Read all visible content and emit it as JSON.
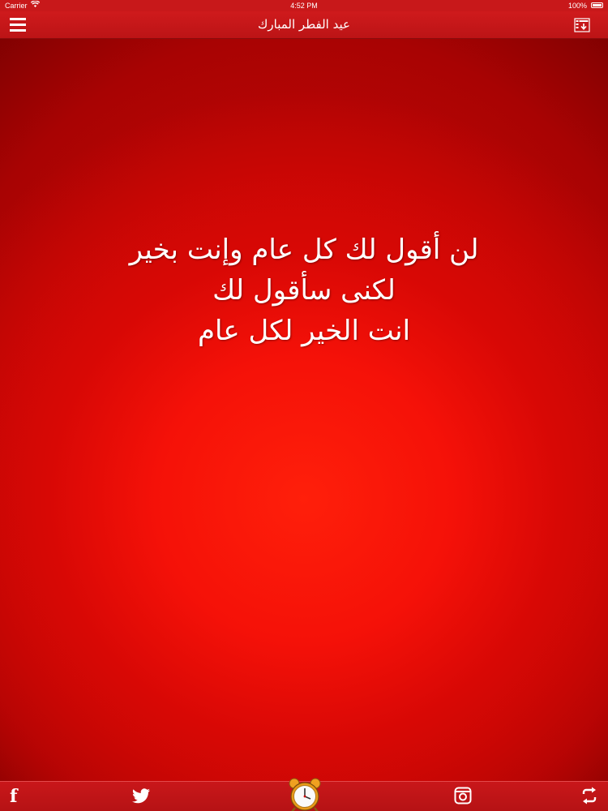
{
  "status_bar": {
    "carrier": "Carrier",
    "time": "4:52 PM",
    "battery": "100%"
  },
  "nav_bar": {
    "title": "عيد الفطر المبارك",
    "menu_icon": "hamburger-menu-icon",
    "download_icon": "list-download-icon"
  },
  "greeting": {
    "lines": [
      "لن أقول لك كل عام وإنت بخير",
      "لكنى سأقول لك",
      "انت الخير لكل عام"
    ]
  },
  "bottom_bar": {
    "facebook_icon": "facebook-icon",
    "twitter_icon": "twitter-bird-icon",
    "clock_icon": "alarm-clock-icon",
    "instagram_icon": "instagram-camera-icon",
    "share_icon": "swap-arrows-icon",
    "facebook_glyph": "f"
  },
  "colors": {
    "bar_red": "#c8181a",
    "background_red": "#f51108",
    "dark_red": "#6a0000"
  }
}
